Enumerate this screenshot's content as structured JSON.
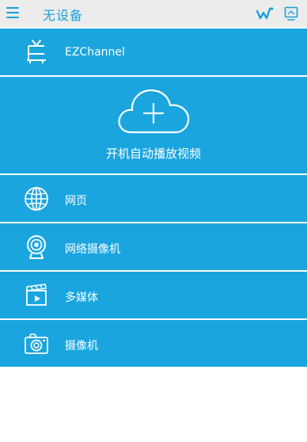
{
  "header": {
    "title": "无设备",
    "menu_icon": "menu-icon",
    "signal_icon": "signal-icon",
    "screen_mirror_icon": "screen-mirror-icon",
    "accent_color": "#1aa0d8"
  },
  "list": {
    "background_color": "#1aa5df",
    "items": [
      {
        "label": "EZChannel",
        "icon": "tv-icon"
      },
      {
        "label": "开机自动播放视频",
        "icon": "cloud-add-icon"
      },
      {
        "label": "网页",
        "icon": "globe-icon"
      },
      {
        "label": "网络摄像机",
        "icon": "webcam-icon"
      },
      {
        "label": "多媒体",
        "icon": "clapperboard-icon"
      },
      {
        "label": "摄像机",
        "icon": "camera-icon"
      }
    ]
  }
}
